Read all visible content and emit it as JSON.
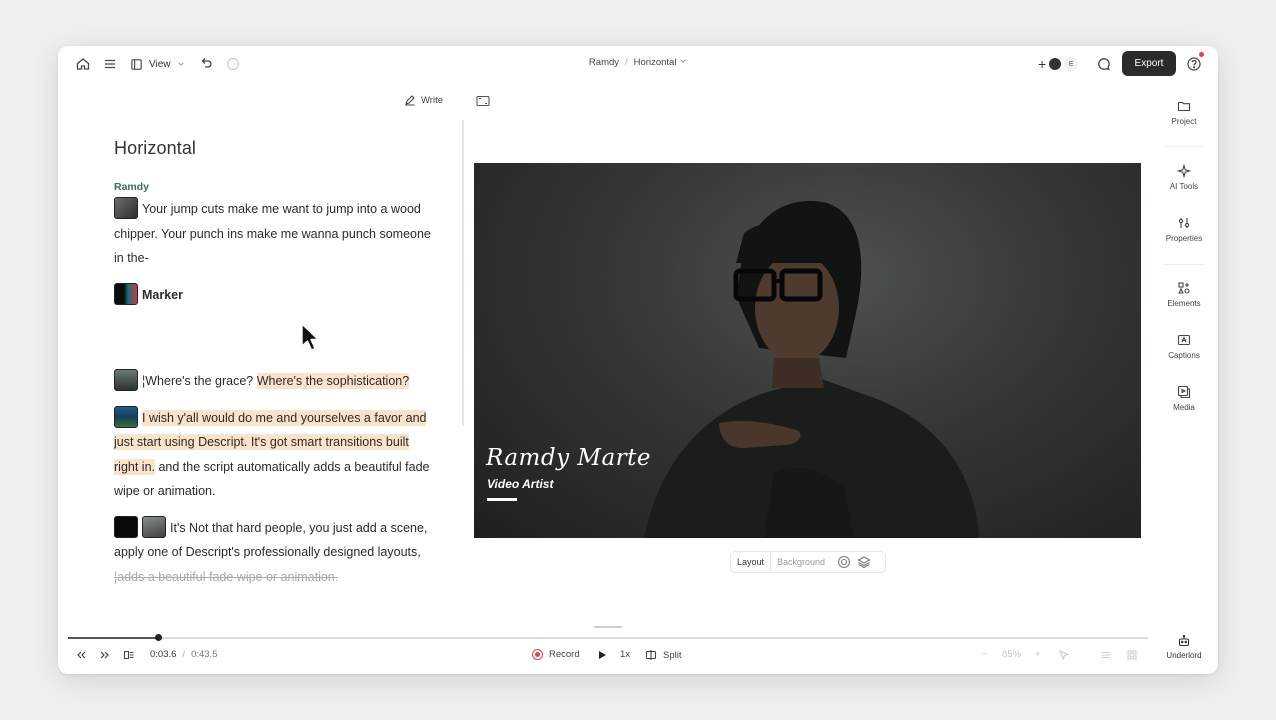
{
  "topbar": {
    "view_label": "View",
    "project_name": "Ramdy",
    "breadcrumb_sep": "/",
    "composition_name": "Horizontal",
    "collab_initial": "E",
    "export_label": "Export"
  },
  "script_panel": {
    "write_label": "Write",
    "doc_title": "Horizontal",
    "speaker": "Ramdy",
    "p1": "Your jump cuts make me want to jump into a wood chipper. Your punch ins make me wanna punch someone in the-",
    "marker_label": "Marker",
    "p3_prefix": "¦",
    "p3_plain": "Where's the grace? ",
    "p3_highlight": "Where's the sophistication?",
    "p4_highlight": "I wish y'all would do me and yourselves a favor and just start using Descript. It's got smart transitions built right in.",
    "p4_plain": " and the script automatically adds a beautiful fade wipe or animation.",
    "p5_plain": "It's Not that hard people, you just add a scene, apply one of Descript's professionally designed layouts, ",
    "p5_prefix": "¦",
    "p5_strike": "adds a beautiful fade wipe or animation."
  },
  "video": {
    "lower_third_name": "Ramdy Marte",
    "lower_third_role": "Video Artist"
  },
  "layout_bar": {
    "layout_label": "Layout",
    "background_label": "Background"
  },
  "rail": {
    "items": [
      {
        "label": "Project",
        "icon": "folder-icon"
      },
      {
        "label": "AI Tools",
        "icon": "sparkle-icon"
      },
      {
        "label": "Properties",
        "icon": "sliders-icon"
      },
      {
        "label": "Elements",
        "icon": "shapes-icon"
      },
      {
        "label": "Captions",
        "icon": "captions-icon"
      },
      {
        "label": "Media",
        "icon": "media-icon"
      }
    ],
    "underlord_label": "Underlord"
  },
  "timeline": {
    "progress": 0.083,
    "current_time": "0:03.6",
    "time_sep": "/",
    "total_time": "0:43.5",
    "record_label": "Record",
    "speed_label": "1x",
    "split_label": "Split",
    "zoom_label": "85%"
  },
  "colors": {
    "highlight": "#fbe2cb",
    "speaker": "#3b6e5a",
    "record": "#e04343",
    "export_bg": "#2b2b2b"
  }
}
